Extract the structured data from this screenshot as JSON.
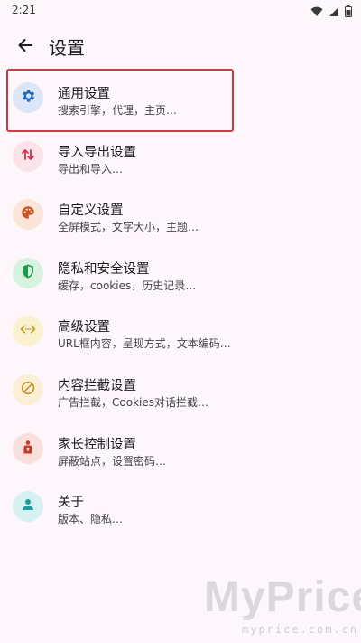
{
  "status_bar": {
    "time": "2:21",
    "icons": [
      "wifi-icon",
      "signal-icon",
      "battery-icon"
    ]
  },
  "app_bar": {
    "title": "设置",
    "back_icon": "arrow-left-icon"
  },
  "settings": [
    {
      "title": "通用设置",
      "subtitle": "搜索引擎，代理，主页…",
      "icon": "gear-icon",
      "bg": "#dbe6f6",
      "fg": "#1f6dc6",
      "highlighted": true
    },
    {
      "title": "导入导出设置",
      "subtitle": "导出和导入…",
      "icon": "import-export-icon",
      "bg": "#fbe3ea",
      "fg": "#d0304f"
    },
    {
      "title": "自定义设置",
      "subtitle": "全屏模式，文字大小，主题…",
      "icon": "palette-icon",
      "bg": "#fbe4d8",
      "fg": "#c65a26"
    },
    {
      "title": "隐私和安全设置",
      "subtitle": "缓存，cookies，历史记录…",
      "icon": "shield-icon",
      "bg": "#d7f2df",
      "fg": "#1e9a48"
    },
    {
      "title": "高级设置",
      "subtitle": "URL框内容，呈现方式，文本编码…",
      "icon": "code-icon",
      "bg": "#faf2cf",
      "fg": "#b39417"
    },
    {
      "title": "内容拦截设置",
      "subtitle": "广告拦截，Cookies对话拦截…",
      "icon": "block-icon",
      "bg": "#fbefd6",
      "fg": "#c58a1f"
    },
    {
      "title": "家长控制设置",
      "subtitle": "屏蔽站点，设置密码…",
      "icon": "parental-icon",
      "bg": "#fae0dc",
      "fg": "#c43a2a"
    },
    {
      "title": "关于",
      "subtitle": "版本、隐私…",
      "icon": "person-icon",
      "bg": "#d5f1f1",
      "fg": "#1f9b9b"
    }
  ],
  "watermark": {
    "logo": "MyPrice",
    "url": "myprice.com.cn"
  }
}
